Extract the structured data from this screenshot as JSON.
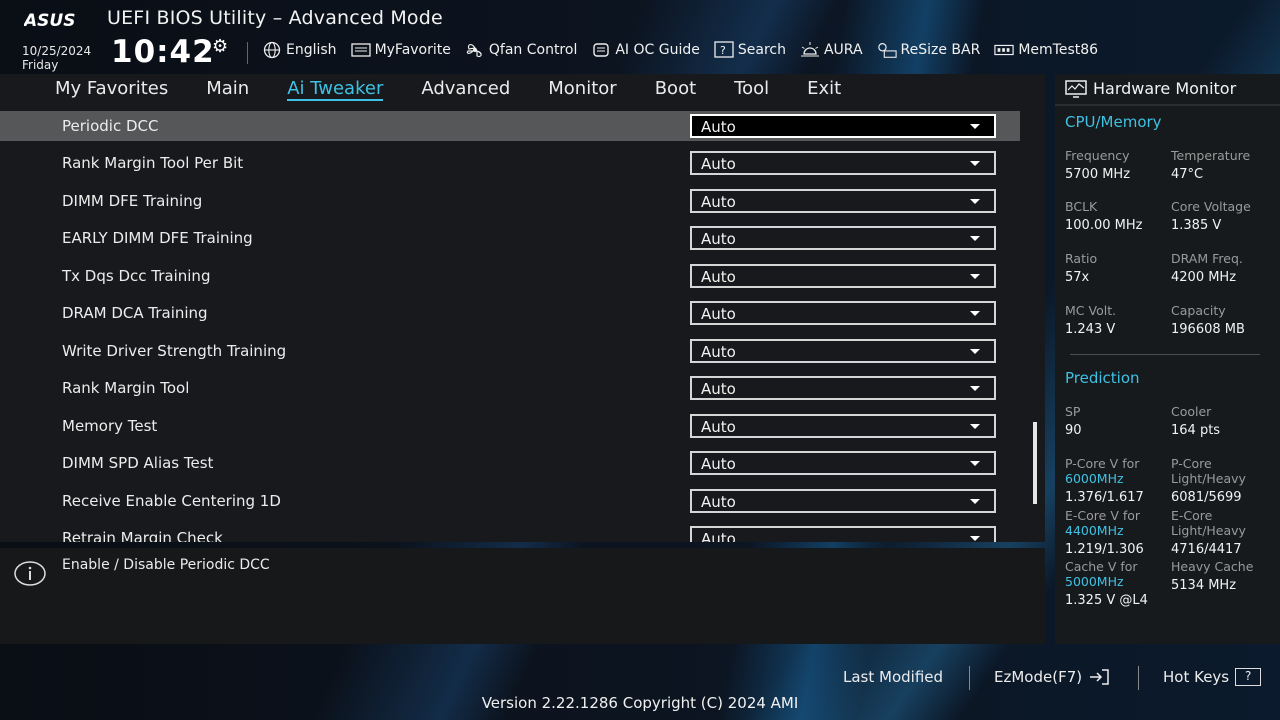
{
  "header": {
    "brand": "ASUS",
    "title": "UEFI BIOS Utility – Advanced Mode",
    "date": "10/25/2024",
    "day": "Friday",
    "time": "10:42",
    "toolbar": [
      {
        "label": "English",
        "icon": "globe-icon"
      },
      {
        "label": "MyFavorite",
        "icon": "favorite-icon"
      },
      {
        "label": "Qfan Control",
        "icon": "fan-icon"
      },
      {
        "label": "AI OC Guide",
        "icon": "ai-oc-icon"
      },
      {
        "label": "Search",
        "icon": "search-icon"
      },
      {
        "label": "AURA",
        "icon": "aura-icon"
      },
      {
        "label": "ReSize BAR",
        "icon": "resize-bar-icon"
      },
      {
        "label": "MemTest86",
        "icon": "memtest-icon"
      }
    ]
  },
  "nav": {
    "tabs": [
      "My Favorites",
      "Main",
      "Ai Tweaker",
      "Advanced",
      "Monitor",
      "Boot",
      "Tool",
      "Exit"
    ],
    "active": "Ai Tweaker"
  },
  "settings": [
    {
      "label": "Periodic DCC",
      "value": "Auto",
      "selected": true
    },
    {
      "label": "Rank Margin Tool Per Bit",
      "value": "Auto"
    },
    {
      "label": "DIMM DFE Training",
      "value": "Auto"
    },
    {
      "label": "EARLY DIMM DFE Training",
      "value": "Auto"
    },
    {
      "label": "Tx Dqs Dcc Training",
      "value": "Auto"
    },
    {
      "label": "DRAM DCA Training",
      "value": "Auto"
    },
    {
      "label": "Write Driver Strength Training",
      "value": "Auto"
    },
    {
      "label": "Rank Margin Tool",
      "value": "Auto"
    },
    {
      "label": "Memory Test",
      "value": "Auto"
    },
    {
      "label": "DIMM SPD Alias Test",
      "value": "Auto"
    },
    {
      "label": "Receive Enable Centering 1D",
      "value": "Auto"
    },
    {
      "label": "Retrain Margin Check",
      "value": "Auto"
    }
  ],
  "help": {
    "text": "Enable / Disable Periodic DCC"
  },
  "hardware_monitor": {
    "title": "Hardware Monitor",
    "cpu_memory": {
      "heading": "CPU/Memory",
      "items": [
        {
          "label": "Frequency",
          "value": "5700 MHz"
        },
        {
          "label": "Temperature",
          "value": "47°C"
        },
        {
          "label": "BCLK",
          "value": "100.00 MHz"
        },
        {
          "label": "Core Voltage",
          "value": "1.385 V"
        },
        {
          "label": "Ratio",
          "value": "57x"
        },
        {
          "label": "DRAM Freq.",
          "value": "4200 MHz"
        },
        {
          "label": "MC Volt.",
          "value": "1.243 V"
        },
        {
          "label": "Capacity",
          "value": "196608 MB"
        }
      ]
    },
    "prediction": {
      "heading": "Prediction",
      "sp_label": "SP",
      "sp_value": "90",
      "cooler_label": "Cooler",
      "cooler_value": "164 pts",
      "pcore_label": "P-Core V for",
      "pcore_freq": "6000MHz",
      "pcore_value": "1.376/1.617",
      "pcore_lh_label": "P-Core Light/Heavy",
      "pcore_lh_value": "6081/5699",
      "ecore_label": "E-Core V for",
      "ecore_freq": "4400MHz",
      "ecore_value": "1.219/1.306",
      "ecore_lh_label": "E-Core Light/Heavy",
      "ecore_lh_value": "4716/4417",
      "cache_label": "Cache V for",
      "cache_freq": "5000MHz",
      "cache_value": "1.325 V @L4",
      "heavy_cache_label": "Heavy Cache",
      "heavy_cache_value": "5134 MHz"
    }
  },
  "footer": {
    "last_modified": "Last Modified",
    "ezmode": "EzMode(F7)",
    "hot_keys": "Hot Keys",
    "hot_keys_key": "?",
    "version": "Version 2.22.1286 Copyright (C) 2024 AMI"
  },
  "colors": {
    "accent": "#3fc1e3",
    "panel": "#17191c",
    "selected_row": "#555759"
  }
}
